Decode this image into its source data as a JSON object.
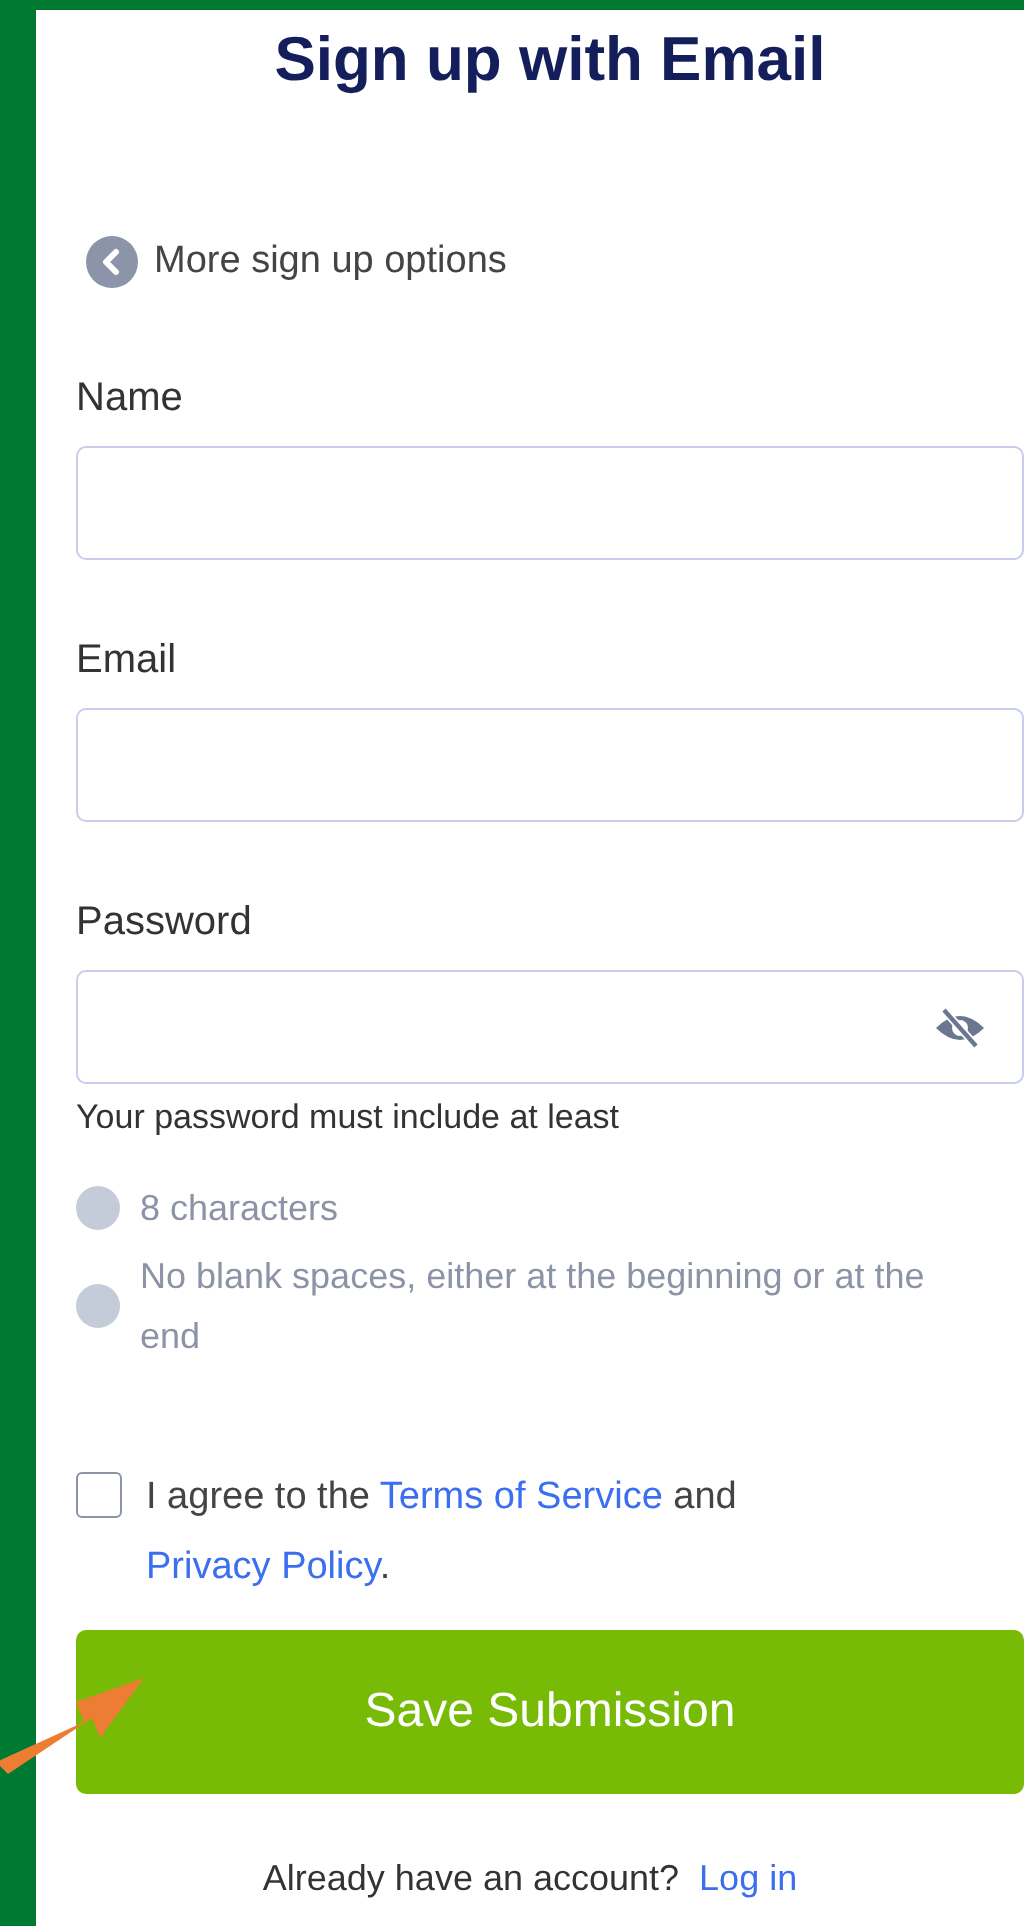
{
  "title": "Sign up with Email",
  "back_link": "More sign up options",
  "fields": [
    {
      "label": "Name",
      "kind": "text"
    },
    {
      "label": "Email",
      "kind": "text"
    },
    {
      "label": "Password",
      "kind": "password",
      "masked": true
    }
  ],
  "password_hint": "Your password must include at least",
  "requirements": [
    {
      "text": "8 characters",
      "met": false
    },
    {
      "text": "No blank spaces, either at the beginning or at the end",
      "met": false
    }
  ],
  "agreement": {
    "checked": false,
    "parts": [
      {
        "kind": "text",
        "text": "I agree to the "
      },
      {
        "kind": "link",
        "text": "Terms of Service"
      },
      {
        "kind": "text",
        "text": " and "
      },
      {
        "kind": "link",
        "text": "Privacy Policy"
      },
      {
        "kind": "text",
        "text": "."
      }
    ]
  },
  "submit_button": "Save Submission",
  "login_prompt": {
    "text": "Already have an account?",
    "link": "Log in"
  }
}
